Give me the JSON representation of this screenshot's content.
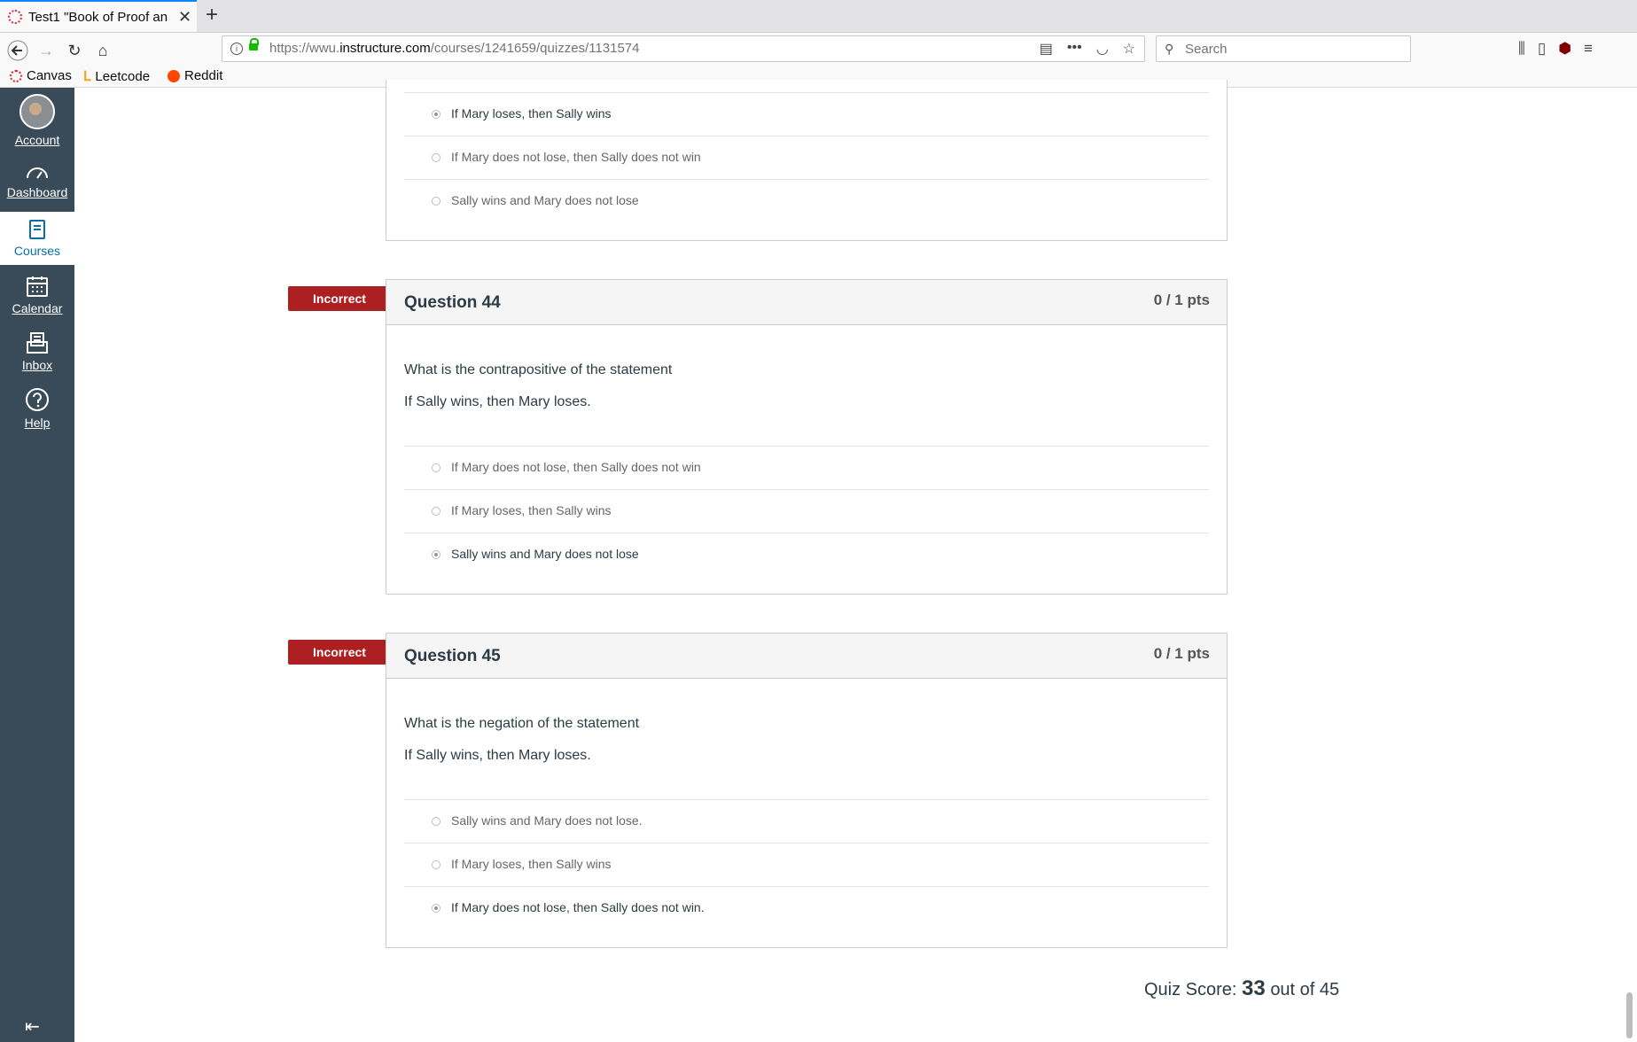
{
  "browser": {
    "tab_title": "Test1 \"Book of Proof an",
    "url_prefix": "https://wwu.",
    "url_domain": "instructure.com",
    "url_path": "/courses/1241659/quizzes/1131574",
    "search_placeholder": "Search",
    "bookmarks": [
      {
        "label": "Canvas",
        "color": "#e0262a"
      },
      {
        "label": "Leetcode",
        "color": "#f89f1b"
      },
      {
        "label": "Reddit",
        "color": "#ff4500"
      }
    ]
  },
  "sidenav": {
    "items": [
      {
        "label": "Account"
      },
      {
        "label": "Dashboard"
      },
      {
        "label": "Courses"
      },
      {
        "label": "Calendar"
      },
      {
        "label": "Inbox"
      },
      {
        "label": "Help"
      }
    ]
  },
  "prev_question": {
    "answers": [
      {
        "text": "If Mary loses, then Sally wins",
        "selected": true
      },
      {
        "text": "If Mary does not lose, then Sally does not win",
        "selected": false
      },
      {
        "text": "Sally wins and Mary does not lose",
        "selected": false
      }
    ]
  },
  "q44": {
    "flag": "Incorrect",
    "title": "Question 44",
    "points": "0 / 1 pts",
    "prompt1": "What is the contrapositive of the statement",
    "prompt2": "If Sally wins, then Mary loses.",
    "answers": [
      {
        "text": "If Mary does not lose, then Sally does not win",
        "selected": false
      },
      {
        "text": "If Mary loses, then Sally wins",
        "selected": false
      },
      {
        "text": "Sally wins and Mary does not lose",
        "selected": true
      }
    ]
  },
  "q45": {
    "flag": "Incorrect",
    "title": "Question 45",
    "points": "0 / 1 pts",
    "prompt1": "What is the negation of the statement",
    "prompt2": "If Sally wins, then Mary loses.",
    "answers": [
      {
        "text": "Sally wins and Mary does not lose.",
        "selected": false
      },
      {
        "text": "If Mary loses, then Sally wins",
        "selected": false
      },
      {
        "text": "If Mary does not lose, then Sally does not win.",
        "selected": true
      }
    ]
  },
  "score": {
    "label": "Quiz Score:",
    "value": "33",
    "suffix": "out of 45"
  },
  "colors": {
    "incorrect_flag": "#ad2021",
    "sidenav_bg": "#394b58",
    "active_nav": "#0770a3"
  }
}
